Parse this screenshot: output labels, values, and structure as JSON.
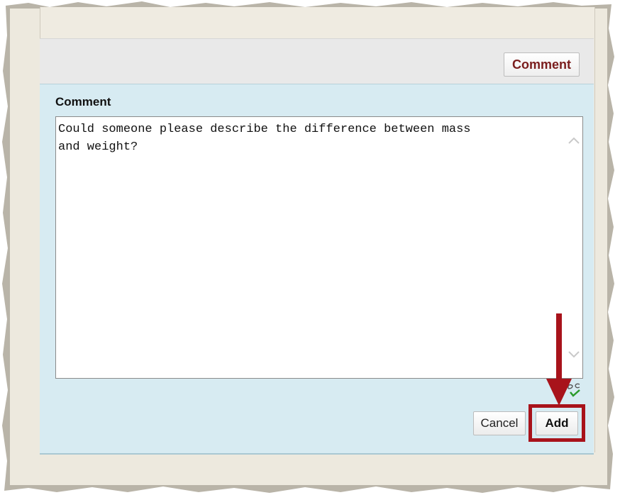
{
  "toolbar": {
    "comment_button_label": "Comment"
  },
  "editor": {
    "field_label": "Comment",
    "text": "Could someone please describe the difference between mass\nand weight?"
  },
  "actions": {
    "cancel_label": "Cancel",
    "add_label": "Add"
  },
  "colors": {
    "accent_red": "#a8131b",
    "panel_blue": "#d7ebf2",
    "comment_text": "#7a1d1d"
  },
  "icons": {
    "scroll_up": "chevron-up-icon",
    "scroll_down": "chevron-down-icon",
    "spellcheck": "spellcheck-icon",
    "annotation_arrow": "arrow-down-icon"
  }
}
